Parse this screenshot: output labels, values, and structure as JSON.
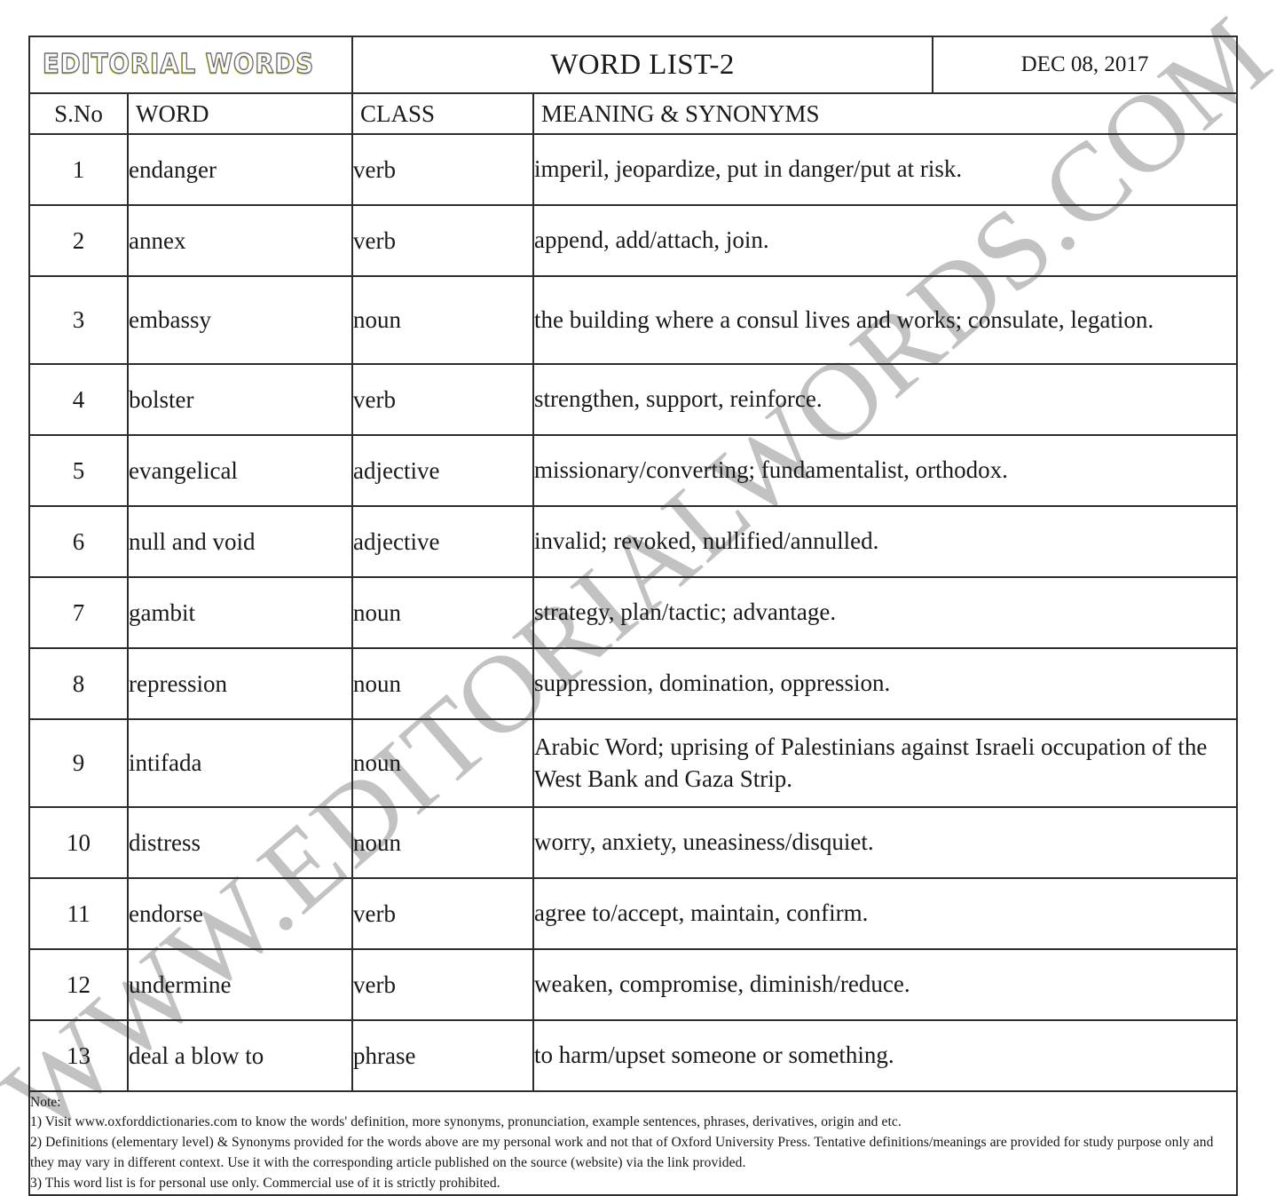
{
  "masthead": {
    "logo": "EDITORIAL WORDS",
    "title": "WORD LIST-2",
    "date": "DEC 08, 2017"
  },
  "watermark": "WWW.EDITORIALWORDS.COM",
  "table": {
    "headers": {
      "sno": "S.No",
      "word": "WORD",
      "class": "CLASS",
      "meaning": "MEANING & SYNONYMS"
    },
    "rows": [
      {
        "sno": "1",
        "word": "endanger",
        "class": "verb",
        "meaning": "imperil, jeopardize, put in danger/put at risk."
      },
      {
        "sno": "2",
        "word": "annex",
        "class": "verb",
        "meaning": "append, add/attach, join."
      },
      {
        "sno": "3",
        "word": "embassy",
        "class": "noun",
        "meaning": "the building where a consul lives and works; consulate, legation."
      },
      {
        "sno": "4",
        "word": "bolster",
        "class": "verb",
        "meaning": "strengthen, support, reinforce."
      },
      {
        "sno": "5",
        "word": "evangelical",
        "class": "adjective",
        "meaning": "missionary/converting; fundamentalist, orthodox."
      },
      {
        "sno": "6",
        "word": "null and void",
        "class": "adjective",
        "meaning": "invalid; revoked, nullified/annulled."
      },
      {
        "sno": "7",
        "word": "gambit",
        "class": "noun",
        "meaning": "strategy, plan/tactic; advantage."
      },
      {
        "sno": "8",
        "word": "repression",
        "class": "noun",
        "meaning": "suppression, domination, oppression."
      },
      {
        "sno": "9",
        "word": "intifada",
        "class": "noun",
        "meaning": "Arabic Word; uprising of Palestinians against Israeli occupation of the West Bank and Gaza Strip."
      },
      {
        "sno": "10",
        "word": "distress",
        "class": "noun",
        "meaning": "worry, anxiety, uneasiness/disquiet."
      },
      {
        "sno": "11",
        "word": "endorse",
        "class": "verb",
        "meaning": "agree to/accept, maintain, confirm."
      },
      {
        "sno": "12",
        "word": "undermine",
        "class": "verb",
        "meaning": "weaken, compromise, diminish/reduce."
      },
      {
        "sno": "13",
        "word": "deal a blow to",
        "class": "phrase",
        "meaning": "to harm/upset someone or something."
      }
    ]
  },
  "note": {
    "heading": "Note:",
    "item1": "1) Visit www.oxforddictionaries.com to know the words' definition, more synonyms, pronunciation, example sentences, phrases, derivatives, origin and etc.",
    "item2": "2) Definitions (elementary level) & Synonyms provided for the words above are my personal work and not that of Oxford University Press. Tentative definitions/meanings are provided for study purpose only and they may vary in different context. Use it with the corresponding article published on the source (website) via the link provided.",
    "item3": "3) This word list is for personal use only. Commercial use of it is strictly prohibited."
  }
}
